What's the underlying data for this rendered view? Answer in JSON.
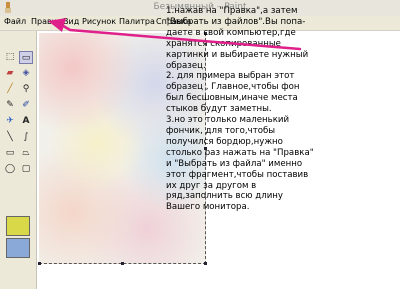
{
  "window": {
    "title": "Безымянный – Paint"
  },
  "menu": {
    "items": [
      {
        "label": "Файл"
      },
      {
        "label": "Правка"
      },
      {
        "label": "Вид"
      },
      {
        "label": "Рисунок"
      },
      {
        "label": "Палитра"
      },
      {
        "label": "Справка"
      }
    ]
  },
  "tools": [
    {
      "icon": "free-select-icon"
    },
    {
      "icon": "rect-select-icon"
    },
    {
      "icon": "eraser-icon"
    },
    {
      "icon": "fill-icon"
    },
    {
      "icon": "picker-icon"
    },
    {
      "icon": "magnifier-icon"
    },
    {
      "icon": "pencil-icon"
    },
    {
      "icon": "brush-icon"
    },
    {
      "icon": "airbrush-icon"
    },
    {
      "icon": "text-icon"
    },
    {
      "icon": "line-icon"
    },
    {
      "icon": "curve-icon"
    },
    {
      "icon": "rectangle-icon"
    },
    {
      "icon": "polygon-icon"
    },
    {
      "icon": "ellipse-icon"
    },
    {
      "icon": "rounded-rect-icon"
    }
  ],
  "annotation": {
    "lines": [
      "1.нажав на \"Правка\",а затем",
      "\"Выбрать  из файлов\".Вы попа-",
      "даете в свой компьютер,где",
      "хранятся скопированные",
      "картинки и выбираете нужный",
      "образец.",
      "2. для примера выбран этот",
      "образец , Главное,чтобы фон",
      "был бесшовным,иначе места",
      "стыков будут заметны.",
      "3.но это только маленький",
      "фончик, для того,чтобы",
      "получился бордюр,нужно",
      "столько раз нажать на \"Правка\"",
      "и \"Выбрать из файла\" именно",
      "этот фрагмент,чтобы поставив",
      "их друг за другом в",
      "ряд,заполнить всю длину",
      "Вашего монитора."
    ]
  },
  "colors": {
    "arrow": "#e0208a",
    "foreground": "#d8d848",
    "background": "#8aa8d8"
  }
}
